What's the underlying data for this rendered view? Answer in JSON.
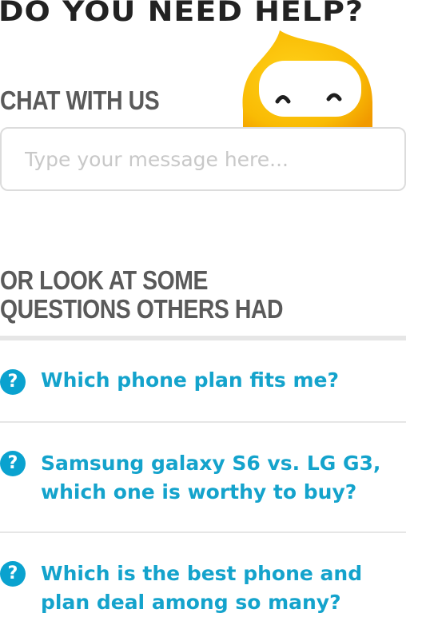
{
  "page": {
    "heading": "DO YOU NEED HELP?"
  },
  "chat": {
    "label": "CHAT WITH US",
    "placeholder": "Type your message here..."
  },
  "mascot": {
    "icon": "mascot-blob-icon",
    "color": "#f7b500"
  },
  "faq": {
    "label": "OR LOOK AT SOME QUESTIONS OTHERS HAD",
    "icon_glyph": "?",
    "accent_color": "#14a3cc",
    "items": [
      {
        "question": "Which phone plan fits me?"
      },
      {
        "question": "Samsung galaxy S6 vs. LG G3, which one is worthy to buy?"
      },
      {
        "question": "Which is the best phone and plan deal among so many?"
      }
    ]
  }
}
